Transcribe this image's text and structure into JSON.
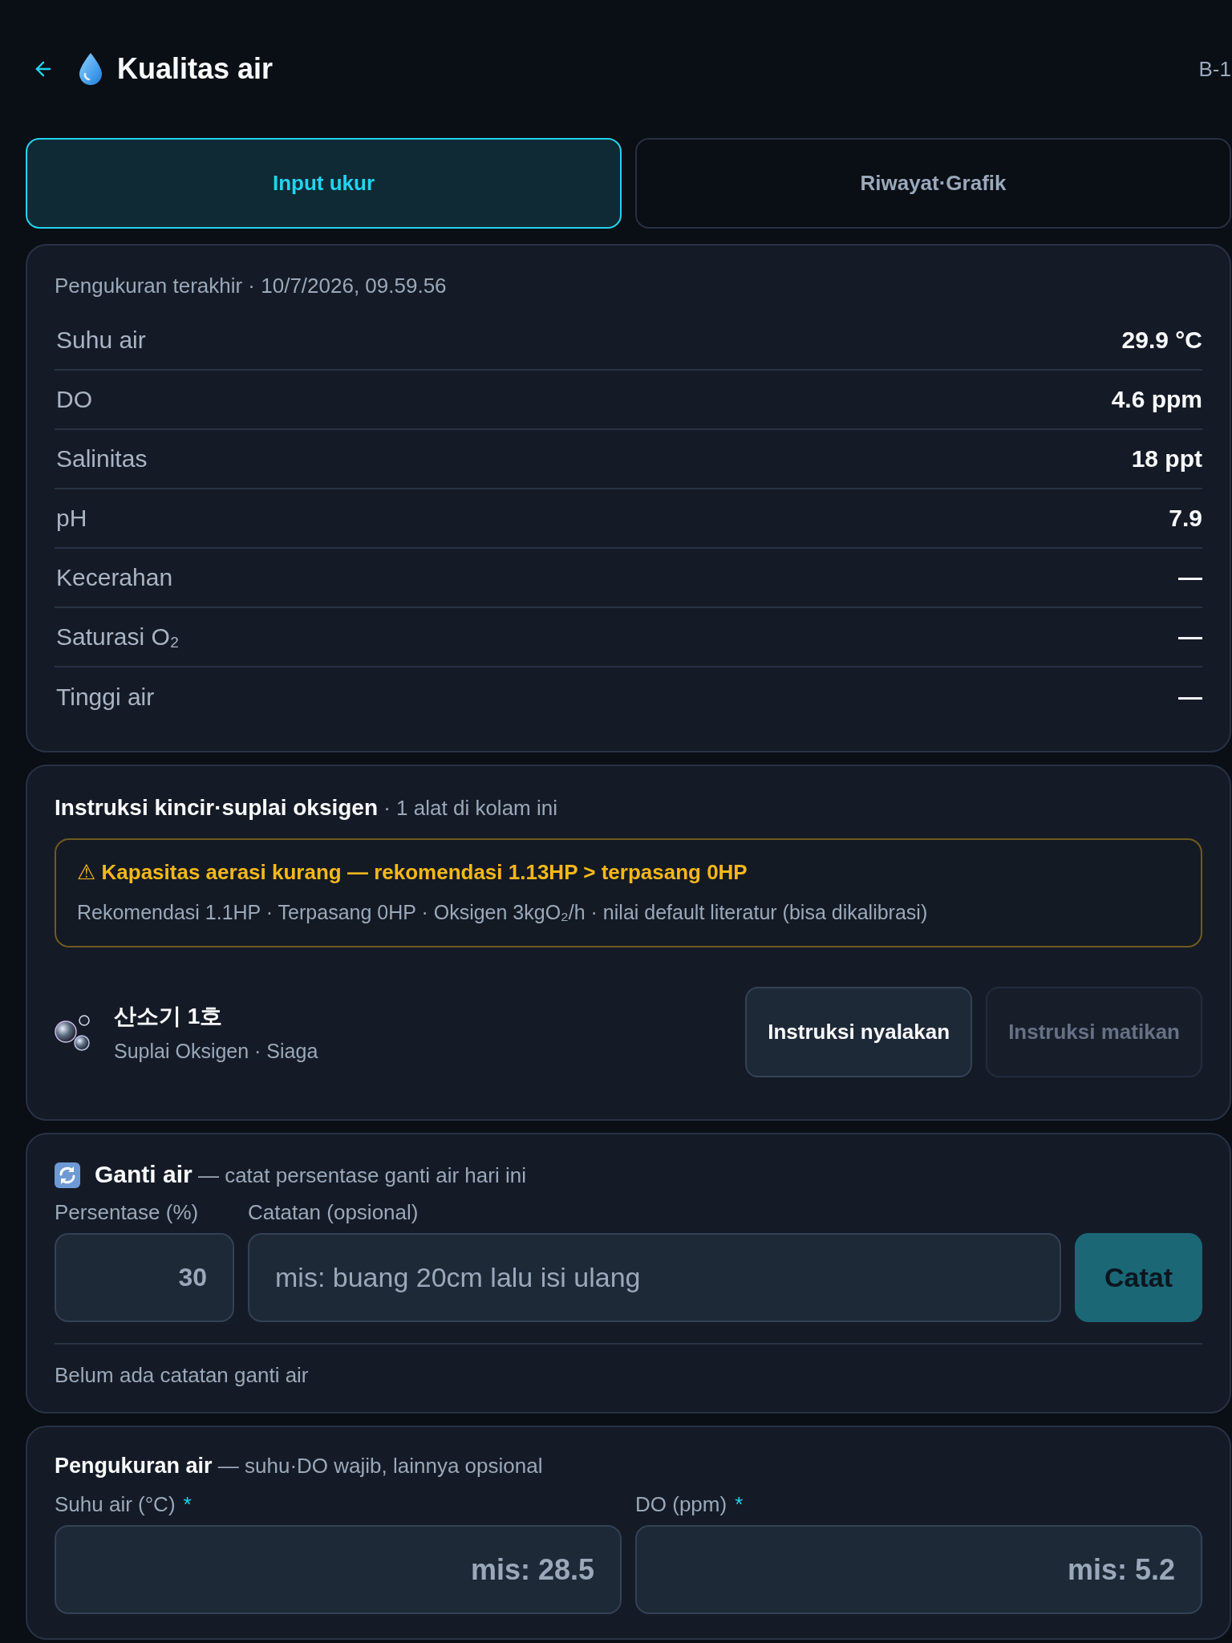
{
  "header": {
    "title": "Kualitas air",
    "pond_code": "B-1"
  },
  "tabs": [
    {
      "label": "Input ukur",
      "selected": true
    },
    {
      "label": "Riwayat·Grafik",
      "selected": false
    }
  ],
  "latest_measurement": {
    "caption": "Pengukuran terakhir · 10/7/2026, 09.59.56",
    "rows": [
      {
        "label": "Suhu air",
        "value": "29.9 °C"
      },
      {
        "label": "DO",
        "value": "4.6 ppm"
      },
      {
        "label": "Salinitas",
        "value": "18 ppt"
      },
      {
        "label": "pH",
        "value": "7.9"
      },
      {
        "label": "Kecerahan",
        "value": "—"
      },
      {
        "label": "Saturasi O₂",
        "value": "—"
      },
      {
        "label": "Tinggi air",
        "value": "—"
      }
    ]
  },
  "aeration": {
    "title": "**Instruksi kincir·suplai oksigen** · 1 alat di kolam ini",
    "warning": {
      "title": "⚠ Kapasitas aerasi kurang — rekomendasi 1.13HP > terpasang 0HP",
      "detail": "Rekomendasi 1.1HP · Terpasang 0HP · Oksigen 3kgO₂/h · nilai default literatur (bisa dikalibrasi)"
    },
    "devices": [
      {
        "name": "산소기 1호",
        "status": "Suplai Oksigen · Siaga",
        "actions": [
          {
            "label": "Instruksi nyalakan",
            "disabled": false
          },
          {
            "label": "Instruksi matikan",
            "disabled": true
          }
        ]
      }
    ]
  },
  "water_change": {
    "title": "**Ganti air** — catat persentase ganti air hari ini",
    "fields": [
      {
        "kind": "number",
        "label": "Persentase (%)",
        "value": "30"
      },
      {
        "kind": "text",
        "label": "Catatan (opsional)",
        "placeholder": "mis: buang 20cm lalu isi ulang"
      }
    ],
    "submit": "Catat",
    "empty_note": "Belum ada catatan ganti air"
  },
  "measurement_form": {
    "title": "**Pengukuran air** — suhu·DO wajib, lainnya opsional",
    "fields": [
      {
        "label": "Suhu air (°C)",
        "required_mark": "*",
        "placeholder": "mis: 28.5"
      },
      {
        "label": "DO (ppm)",
        "required_mark": "*",
        "placeholder": "mis: 5.2"
      }
    ]
  }
}
